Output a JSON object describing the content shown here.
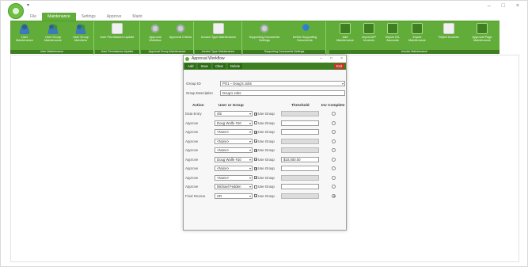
{
  "window": {
    "minimize": "–",
    "maximize": "□",
    "close": "×",
    "qat": "▾"
  },
  "tabs": [
    "File",
    "Maintenance",
    "Settings",
    "Approve",
    "Maint"
  ],
  "ribbon": {
    "groups": [
      {
        "label": "User Maintenance",
        "buttons": [
          "User Maintenance",
          "User Group Maintenance",
          "User Group Members"
        ]
      },
      {
        "label": "User Permissions Update",
        "buttons": [
          "User Permissions Update"
        ]
      },
      {
        "label": "Approval Group Maintenance",
        "buttons": [
          "Approval Workflow",
          "Approval Criteria"
        ]
      },
      {
        "label": "Invoice Type Maintenance",
        "buttons": [
          "Invoice Type Maintenance"
        ]
      },
      {
        "label": "Supporting Documents Settings",
        "buttons": [
          "Supporting Documents Settings",
          "Define Supporting Documents"
        ]
      },
      {
        "label": "Invoice Maintenance",
        "buttons": [
          "Add Maintenance",
          "Import A/P Invoices",
          "Import G/L Accounts",
          "Export Maintenance",
          "Reject Invoices",
          "Approval Page Maintenance"
        ]
      }
    ]
  },
  "dialog": {
    "title": "Approval Workflow",
    "toolbar": {
      "add": "Add",
      "save": "Save",
      "clear": "Clear",
      "delete": "Delete",
      "exit": "Exit"
    },
    "group_id_label": "Group ID",
    "group_id_value": "PO1 – Doug's Jobs",
    "group_desc_label": "Group Description",
    "group_desc_value": "Doug's Jobs",
    "headers": {
      "action": "Action",
      "user_or_group": "User or Group",
      "threshold": "Threshold",
      "inv_complete": "Inv Complete"
    },
    "use_group_label": "Use Group",
    "rows": [
      {
        "action": "Data Entry",
        "user": "OE",
        "use_group": true,
        "threshold": "",
        "threshold_enabled": false,
        "complete": false
      },
      {
        "action": "Approve",
        "user": "Doug Wolfe #10",
        "use_group": false,
        "threshold": "",
        "threshold_enabled": true,
        "complete": false
      },
      {
        "action": "Approve",
        "user": "<None>",
        "use_group": true,
        "threshold": "",
        "threshold_enabled": true,
        "complete": false
      },
      {
        "action": "Approve",
        "user": "<None>",
        "use_group": true,
        "threshold": "",
        "threshold_enabled": false,
        "complete": false
      },
      {
        "action": "Approve",
        "user": "<None>",
        "use_group": true,
        "threshold": "",
        "threshold_enabled": false,
        "complete": false
      },
      {
        "action": "Approve",
        "user": "Doug Wolfe #10",
        "use_group": true,
        "threshold": "$10,000.00",
        "threshold_enabled": true,
        "complete": false
      },
      {
        "action": "Approve",
        "user": "<None>",
        "use_group": true,
        "threshold": "",
        "threshold_enabled": true,
        "complete": false
      },
      {
        "action": "Approve",
        "user": "<None>",
        "use_group": true,
        "threshold": "",
        "threshold_enabled": false,
        "complete": false
      },
      {
        "action": "Approve",
        "user": "Michael Fedden",
        "use_group": false,
        "threshold": "",
        "threshold_enabled": true,
        "complete": false
      },
      {
        "action": "Final Review",
        "user": "HR",
        "use_group": true,
        "threshold": "",
        "threshold_enabled": false,
        "complete": true
      }
    ]
  }
}
